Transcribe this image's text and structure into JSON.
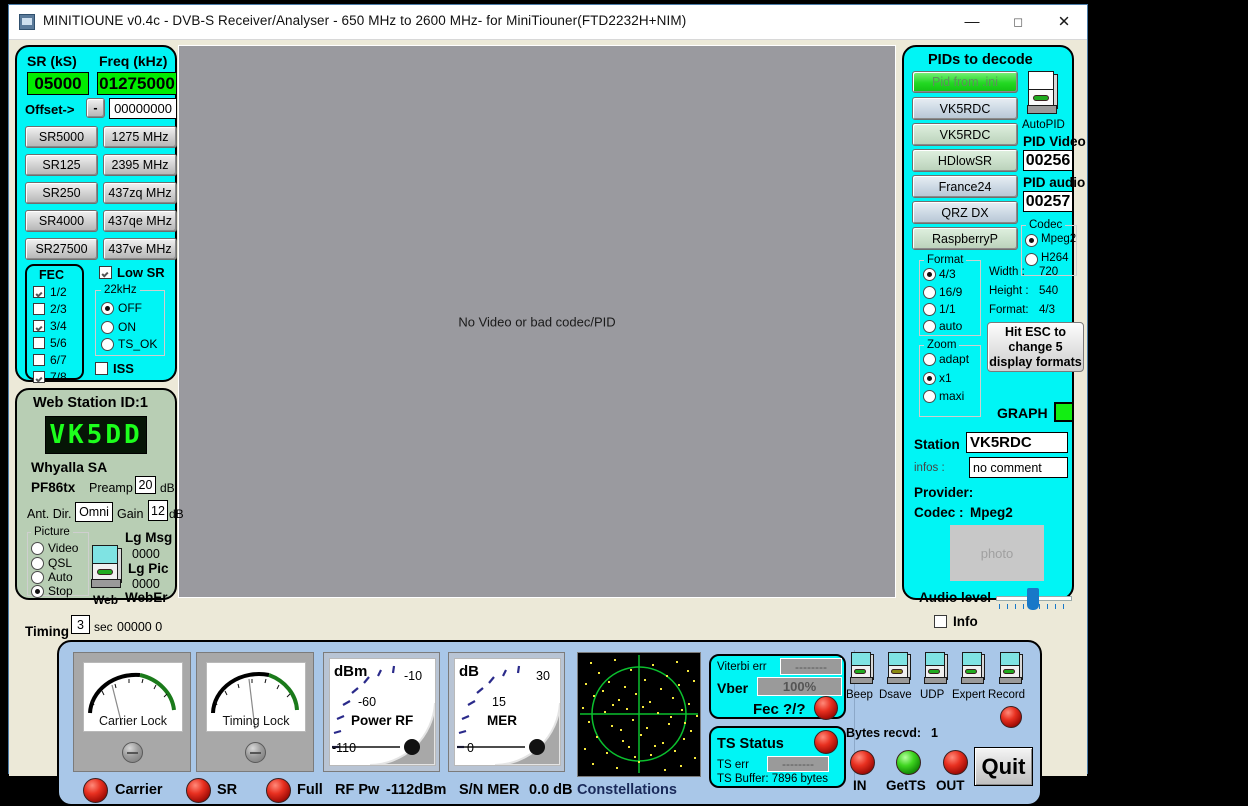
{
  "window": {
    "title": "MINITIOUNE v0.4c - DVB-S Receiver/Analyser - 650 MHz to 2600 MHz- for MiniTiouner(FTD2232H+NIM)",
    "minimize": "—",
    "maximize": "□",
    "close": "✕"
  },
  "video": {
    "message": "No Video or bad codec/PID"
  },
  "tuner": {
    "sr_header": "SR (kS)",
    "freq_header": "Freq (kHz)",
    "sr_value": "05000",
    "freq_value": "01275000",
    "offset_label": "Offset->",
    "offset_sign": "-",
    "offset_value": "00000000",
    "sr_presets": [
      "SR5000",
      "SR125",
      "SR250",
      "SR4000",
      "SR27500"
    ],
    "freq_presets": [
      "1275 MHz",
      "2395 MHz",
      "437zq MHz",
      "437qe MHz",
      "437ve MHz"
    ],
    "fec_label": "FEC",
    "fec_items": [
      {
        "label": "1/2",
        "checked": true
      },
      {
        "label": "2/3",
        "checked": false
      },
      {
        "label": "3/4",
        "checked": true
      },
      {
        "label": "5/6",
        "checked": false
      },
      {
        "label": "6/7",
        "checked": false
      },
      {
        "label": "7/8",
        "checked": true
      }
    ],
    "low_sr_label": "Low SR",
    "low_sr_checked": true,
    "k22_label": "22kHz",
    "k22_options": [
      "OFF",
      "ON",
      "TS_OK"
    ],
    "k22_selected": "OFF",
    "iss_label": "ISS",
    "iss_checked": false
  },
  "webstation": {
    "title": "Web Station ID:1",
    "callsign": "VK5DD",
    "location": "Whyalla SA",
    "locator": "PF86tx",
    "preamp_label": "Preamp",
    "preamp_value": "20",
    "preamp_unit": "dB",
    "antdir_label": "Ant. Dir.",
    "antdir_value": "Omni",
    "gain_label": "Gain",
    "gain_value": "12",
    "gain_unit": "dB",
    "picture_label": "Picture",
    "picture_options": [
      "Video",
      "QSL",
      "Auto",
      "Stop"
    ],
    "picture_selected": "Stop",
    "web_switch_label": "Web",
    "lgmsg_label": "Lg Msg",
    "lgmsg_value": "0000",
    "lgpic_label": "Lg Pic",
    "lgpic_value": "0000",
    "weber_label": "WebEr",
    "weber_value": "00000  0",
    "timing_label": "Timing",
    "timing_value": "3",
    "timing_unit": "sec"
  },
  "pids": {
    "title": "PIDs to decode",
    "buttons": [
      {
        "label": "Pid from .ini",
        "state": "active"
      },
      {
        "label": "VK5RDC",
        "state": "blue"
      },
      {
        "label": "VK5RDC",
        "state": "green"
      },
      {
        "label": "HDlowSR",
        "state": "green"
      },
      {
        "label": "France24",
        "state": "blue"
      },
      {
        "label": "QRZ DX",
        "state": "blue"
      },
      {
        "label": "RaspberryP",
        "state": "green"
      }
    ],
    "autopid_label": "AutoPID",
    "pid_video_label": "PID Video",
    "pid_video_value": "00256",
    "pid_audio_label": "PID audio",
    "pid_audio_value": "00257",
    "codec_label": "Codec",
    "codec_options": [
      "Mpeg2",
      "H264"
    ],
    "codec_selected": "Mpeg2",
    "format_label": "Format",
    "format_options": [
      "4/3",
      "16/9",
      "1/1",
      "auto"
    ],
    "format_selected": "4/3",
    "zoom_label": "Zoom",
    "zoom_options": [
      "adapt",
      "x1",
      "maxi"
    ],
    "zoom_selected": "x1",
    "width_label": "Width :",
    "width_value": "720",
    "height_label": "Height :",
    "height_value": "540",
    "format_info_label": "Format:",
    "format_info_value": "4/3",
    "esc_hint": "Hit ESC to change  5 display formats",
    "graph_label": "GRAPH",
    "station_label": "Station",
    "station_value": "VK5RDC",
    "infos_label": "infos :",
    "infos_value": "no comment",
    "provider_label": "Provider:",
    "codec_info_label": "Codec :",
    "codec_info_value": "Mpeg2",
    "photo_placeholder": "photo",
    "audio_level_label": "Audio level",
    "info_label": "Info",
    "info_checked": false
  },
  "meters": {
    "carrier_lock_label": "Carrier Lock",
    "timing_lock_label": "Timing Lock",
    "power_unit": "dBm",
    "power_label": "Power RF",
    "power_ticks": [
      "-10",
      "-60",
      "-110"
    ],
    "mer_unit": "dB",
    "mer_label": "MER",
    "mer_ticks": [
      "30",
      "15",
      "0"
    ],
    "constellations_label": "Constellations",
    "status_leds": [
      {
        "label": "Carrier",
        "color": "red"
      },
      {
        "label": "SR",
        "color": "red"
      },
      {
        "label": "Full",
        "color": "red"
      }
    ],
    "rf_pw_label": "RF Pw",
    "rf_pw_value": "-112dBm",
    "snr_label": "S/N MER",
    "snr_value": "0.0 dB"
  },
  "ts": {
    "viterbi_label": "Viterbi err",
    "viterbi_value": "--------",
    "vber_label": "Vber",
    "vber_value": "100%",
    "fec_label": "Fec ?/?",
    "ts_status_label": "TS Status",
    "ts_err_label": "TS err",
    "ts_err_value": "--------",
    "ts_buffer_label": "TS Buffer: 7896 bytes"
  },
  "controls": {
    "switches": [
      "Beep",
      "Dsave",
      "UDP",
      "Expert",
      "Record"
    ],
    "bytes_label": "Bytes recvd:",
    "bytes_value": "1",
    "io_leds": [
      {
        "label": "IN",
        "color": "red"
      },
      {
        "label": "GetTS",
        "color": "green"
      },
      {
        "label": "OUT",
        "color": "red"
      }
    ],
    "quit_label": "Quit"
  }
}
